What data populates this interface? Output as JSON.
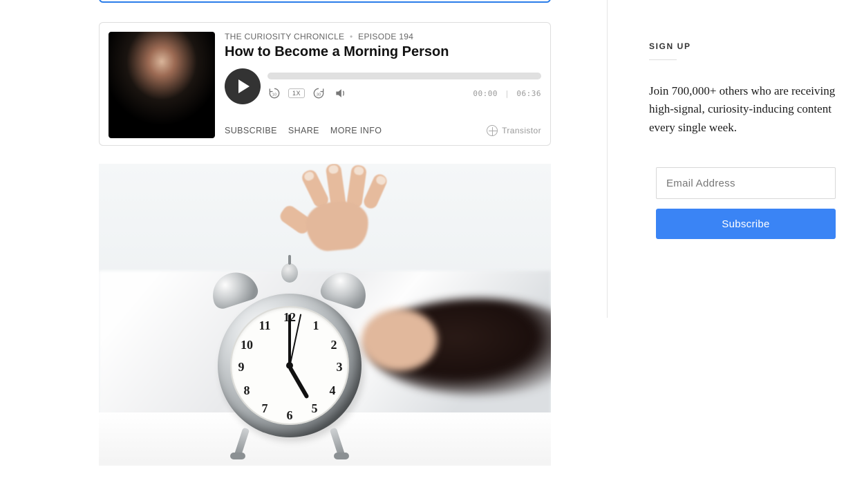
{
  "player": {
    "show_name": "THE CURIOSITY CHRONICLE",
    "episode_label": "EPISODE 194",
    "title": "How to Become a Morning Person",
    "speed": "1X",
    "time_current": "00:00",
    "time_total": "06:36",
    "links": {
      "subscribe": "SUBSCRIBE",
      "share": "SHARE",
      "more_info": "MORE INFO"
    },
    "brand": "Transistor"
  },
  "sidebar": {
    "heading": "SIGN UP",
    "copy": "Join 700,000+ others who are receiving high-signal, curiosity-inducing content every single week.",
    "email_placeholder": "Email Address",
    "button": "Subscribe"
  },
  "clock": {
    "numerals": [
      "12",
      "1",
      "2",
      "3",
      "4",
      "5",
      "6",
      "7",
      "8",
      "9",
      "10",
      "11"
    ]
  }
}
